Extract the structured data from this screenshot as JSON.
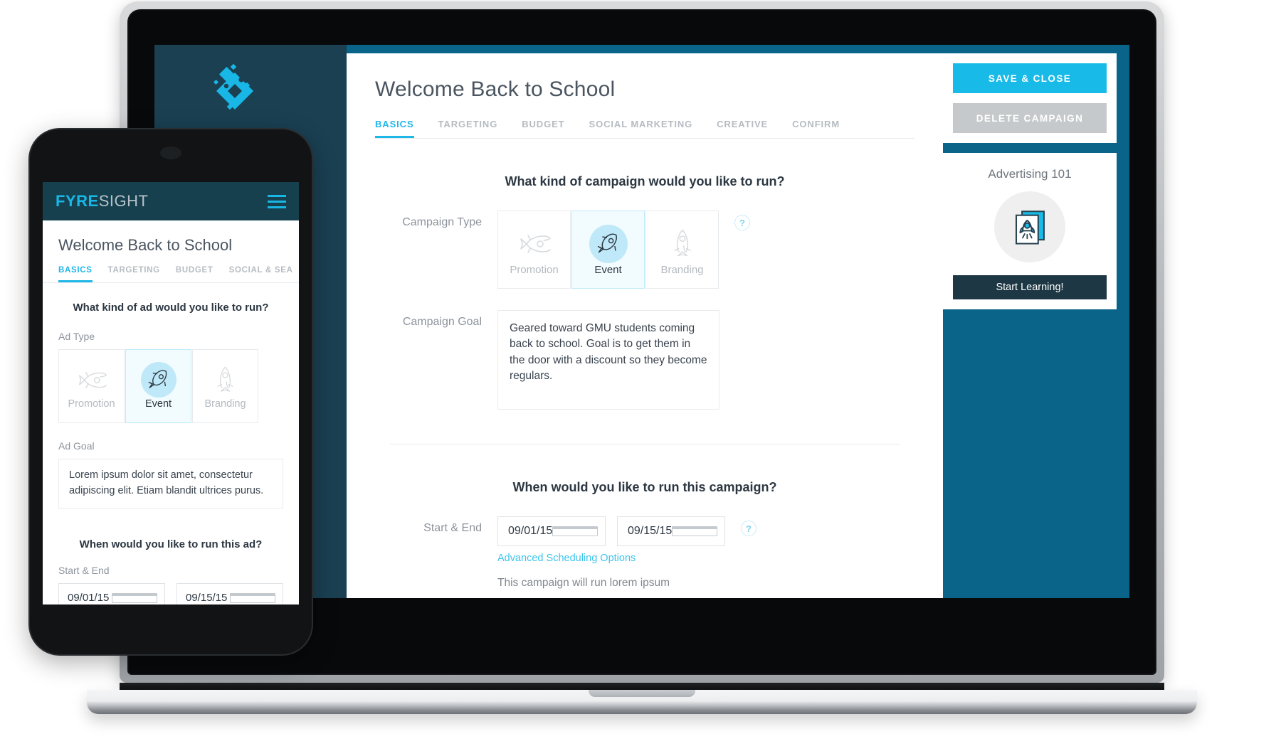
{
  "desktop": {
    "logo_icon": "fyresight-diamond-logo-icon",
    "title": "Welcome Back to School",
    "tabs": [
      {
        "label": "BASICS",
        "active": true
      },
      {
        "label": "TARGETING",
        "active": false
      },
      {
        "label": "BUDGET",
        "active": false
      },
      {
        "label": "SOCIAL MARKETING",
        "active": false
      },
      {
        "label": "CREATIVE",
        "active": false
      },
      {
        "label": "CONFIRM",
        "active": false
      }
    ],
    "question_campaign": "What kind of campaign would you like to run?",
    "campaign_type_label": "Campaign Type",
    "campaign_types": [
      {
        "label": "Promotion",
        "icon": "rocket-horizontal-icon",
        "selected": false
      },
      {
        "label": "Event",
        "icon": "rocket-diagonal-icon",
        "selected": true
      },
      {
        "label": "Branding",
        "icon": "rocket-vertical-icon",
        "selected": false
      }
    ],
    "campaign_goal_label": "Campaign Goal",
    "campaign_goal_value": "Geared toward GMU students coming back to school. Goal is to get them in the door with a discount so they become regulars.",
    "help_icon": "?",
    "question_schedule": "When would you like to run this campaign?",
    "schedule_label": "Start & End",
    "start_date": "09/01/15",
    "end_date": "09/15/15",
    "advanced_link": "Advanced Scheduling Options",
    "run_note": "This campaign will run lorem ipsum"
  },
  "sidebar_panel": {
    "save_label": "SAVE & CLOSE",
    "delete_label": "DELETE CAMPAIGN",
    "card_title": "Advertising 101",
    "card_icon": "rocket-on-cards-icon",
    "learn_label": "Start Learning!"
  },
  "phone": {
    "logo_primary": "FYRE",
    "logo_secondary": "SIGHT",
    "menu_icon": "hamburger-menu-icon",
    "title": "Welcome Back to School",
    "tabs": [
      {
        "label": "BASICS",
        "active": true
      },
      {
        "label": "TARGETING",
        "active": false
      },
      {
        "label": "BUDGET",
        "active": false
      },
      {
        "label": "SOCIAL & SEA",
        "active": false
      }
    ],
    "question_ad": "What kind of ad would you like to run?",
    "ad_type_label": "Ad Type",
    "ad_types": [
      {
        "label": "Promotion",
        "icon": "rocket-horizontal-icon",
        "selected": false
      },
      {
        "label": "Event",
        "icon": "rocket-diagonal-icon",
        "selected": true
      },
      {
        "label": "Branding",
        "icon": "rocket-vertical-icon",
        "selected": false
      }
    ],
    "ad_goal_label": "Ad Goal",
    "ad_goal_value": "Lorem ipsum dolor sit amet, consectetur adipiscing elit. Etiam blandit ultrices purus.",
    "question_schedule": "When would you like to run this ad?",
    "schedule_label": "Start & End",
    "start_date": "09/01/15",
    "end_date": "09/15/15"
  },
  "colors": {
    "accent_cyan": "#18bae8",
    "panel_blue": "#0a6389",
    "dark_teal": "#1a4052",
    "delete_gray": "#c6c9cb",
    "learn_navy": "#1e3744"
  }
}
